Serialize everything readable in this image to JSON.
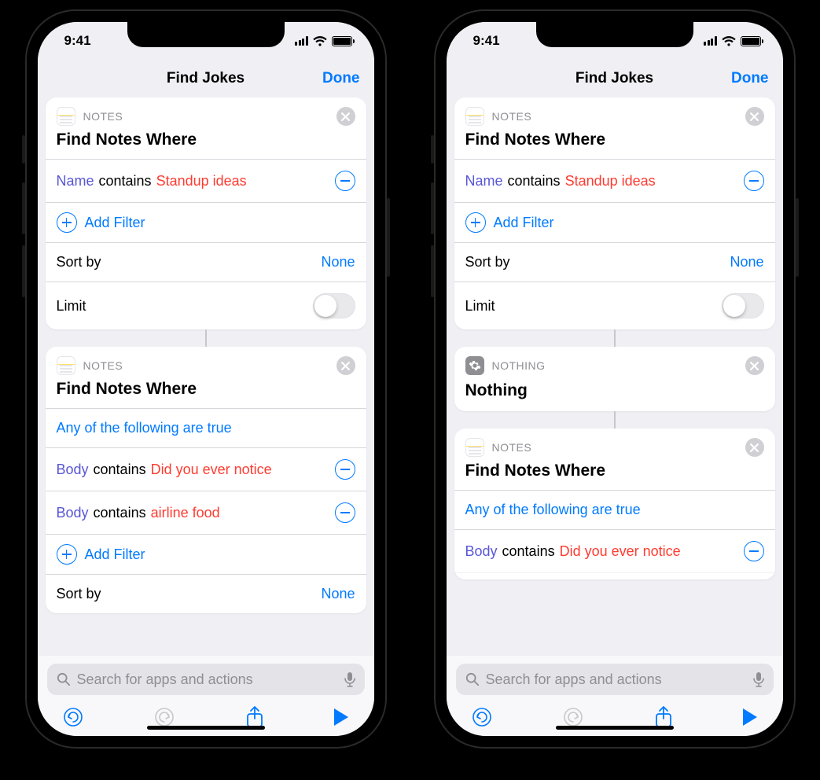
{
  "status": {
    "time": "9:41"
  },
  "nav": {
    "title": "Find Jokes",
    "done": "Done"
  },
  "labels": {
    "notes_app": "NOTES",
    "nothing_app": "NOTHING",
    "find_notes_where": "Find Notes Where",
    "nothing_title": "Nothing",
    "add_filter": "Add Filter",
    "sort_by": "Sort by",
    "none": "None",
    "limit": "Limit",
    "any_true": "Any of the following are true",
    "search_placeholder": "Search for apps and actions"
  },
  "left": {
    "card1": {
      "filters": [
        {
          "field": "Name",
          "op": "contains",
          "value": "Standup ideas"
        }
      ]
    },
    "card2": {
      "filters": [
        {
          "field": "Body",
          "op": "contains",
          "value": "Did you ever notice"
        },
        {
          "field": "Body",
          "op": "contains",
          "value": "airline food"
        }
      ]
    }
  },
  "right": {
    "card1": {
      "filters": [
        {
          "field": "Name",
          "op": "contains",
          "value": "Standup ideas"
        }
      ]
    },
    "card3": {
      "filters": [
        {
          "field": "Body",
          "op": "contains",
          "value": "Did you ever notice"
        }
      ]
    }
  }
}
